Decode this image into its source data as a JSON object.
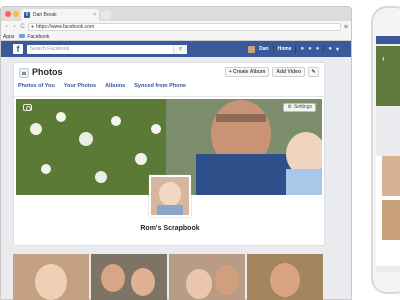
{
  "browser": {
    "tab_title": "Dan Borak",
    "tab_close": "×",
    "back": "‹",
    "forward": "›",
    "reload": "C",
    "url": "https://www.facebook.com",
    "menu": "≡"
  },
  "bookmarks": {
    "apps": "Apps",
    "facebook": "Facebook"
  },
  "fb_header": {
    "logo": "f",
    "search_placeholder": "Search Facebook",
    "search_icon": "⌕",
    "user_name": "Dan",
    "home": "Home",
    "friends_icon": "friends-icon",
    "messages_icon": "messages-icon",
    "notifications_icon": "globe-icon",
    "color": "#3b5998"
  },
  "photos_page": {
    "title": "Photos",
    "create_album": "+ Create Album",
    "add_video": "Add Video",
    "edit_icon": "✎",
    "tabs": [
      "Photos of You",
      "Your Photos",
      "Albums",
      "Synced from Phone"
    ]
  },
  "album": {
    "settings_label": "Settings",
    "settings_icon": "⚙",
    "name": "Rom's Scrapbook"
  },
  "phone": {
    "back_icon": "‹"
  }
}
